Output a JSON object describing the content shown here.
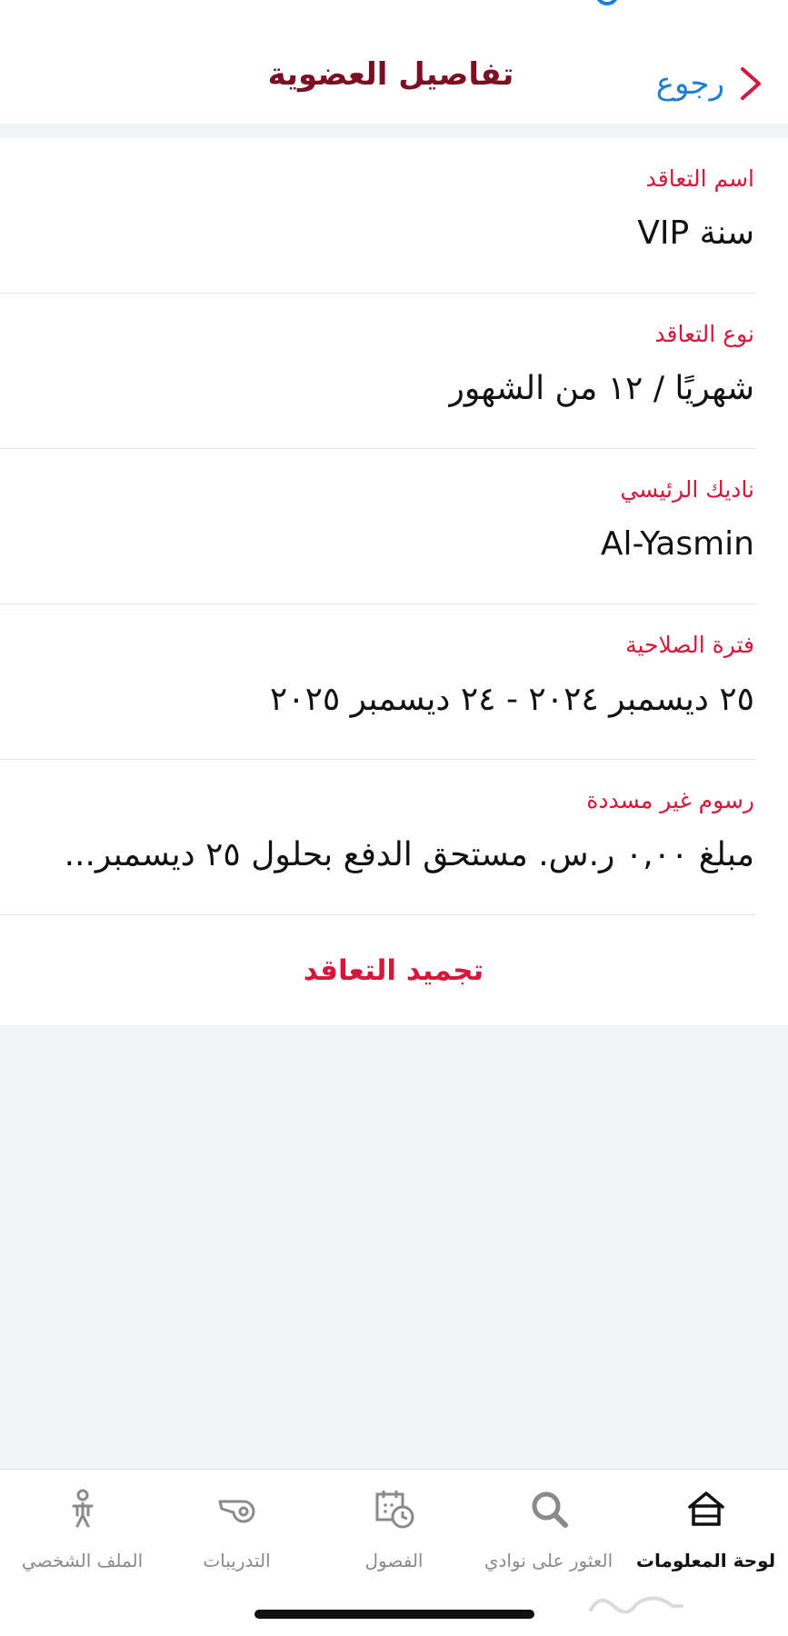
{
  "header": {
    "title": "تفاصيل العضوية",
    "back_label": "رجوع"
  },
  "details": [
    {
      "label": "اسم التعاقد",
      "value": "سنة VIP"
    },
    {
      "label": "نوع التعاقد",
      "value": "شهريًا / ١٢ من الشهور"
    },
    {
      "label": "ناديك الرئيسي",
      "value": "Al-Yasmin"
    },
    {
      "label": "فترة الصلاحية",
      "value": "٢٥ ديسمبر ٢٠٢٤ - ٢٤ ديسمبر ٢٠٢٥"
    },
    {
      "label": "رسوم غير مسددة",
      "value": "مبلغ ٠,٠٠ ر.س. مستحق الدفع بحلول ٢٥ ديسمبر..."
    }
  ],
  "freeze_label": "تجميد التعاقد",
  "tabs": [
    {
      "label": "لوحة المعلومات",
      "icon": "home-icon",
      "active": true
    },
    {
      "label": "العثور على نوادي",
      "icon": "search-icon",
      "active": false
    },
    {
      "label": "الفصول",
      "icon": "calendar-clock-icon",
      "active": false
    },
    {
      "label": "التدريبات",
      "icon": "whistle-icon",
      "active": false
    },
    {
      "label": "الملف الشخصي",
      "icon": "person-icon",
      "active": false
    }
  ],
  "colors": {
    "accent_red": "#d6163a",
    "title_maroon": "#7a1022",
    "link_blue": "#1c7ed6"
  }
}
